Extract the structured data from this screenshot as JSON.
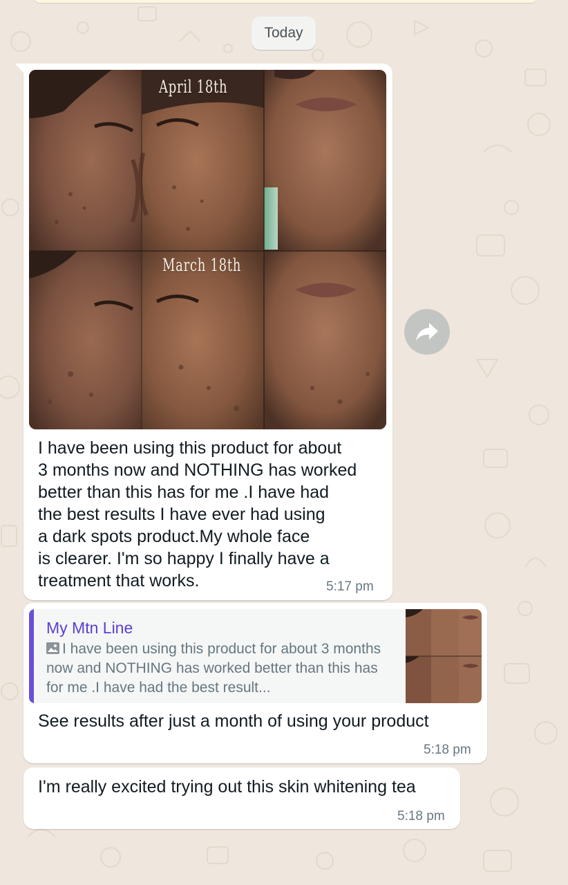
{
  "header": {
    "date_chip": "Today"
  },
  "messages": [
    {
      "id": "m1",
      "collage_labels": {
        "top": "April 18th",
        "bottom": "March 18th"
      },
      "text": "I have been using this product for about\n3 months now and NOTHING has worked\nbetter than this has for me .I have had\nthe best results I have ever had using\na dark spots product.My whole face\nis clearer. I'm so happy I finally have a\ntreatment that works.",
      "time": "5:17 pm"
    },
    {
      "id": "m2",
      "quote": {
        "author": "My Mtn Line",
        "text": "I have been using this product for about 3 months now and NOTHING has worked better than this has for me .I have had the best result..."
      },
      "text": "See results after just a month of using your product",
      "time": "5:18 pm"
    },
    {
      "id": "m3",
      "text": "I'm really excited trying out this skin whitening tea",
      "time": "5:18 pm"
    }
  ],
  "icons": {
    "forward": "forward-arrow-icon",
    "photo": "photo-icon"
  },
  "colors": {
    "chat_background": "#efe7de",
    "bubble": "#ffffff",
    "quote_accent": "#6b4fd8",
    "meta_text": "#667781"
  }
}
